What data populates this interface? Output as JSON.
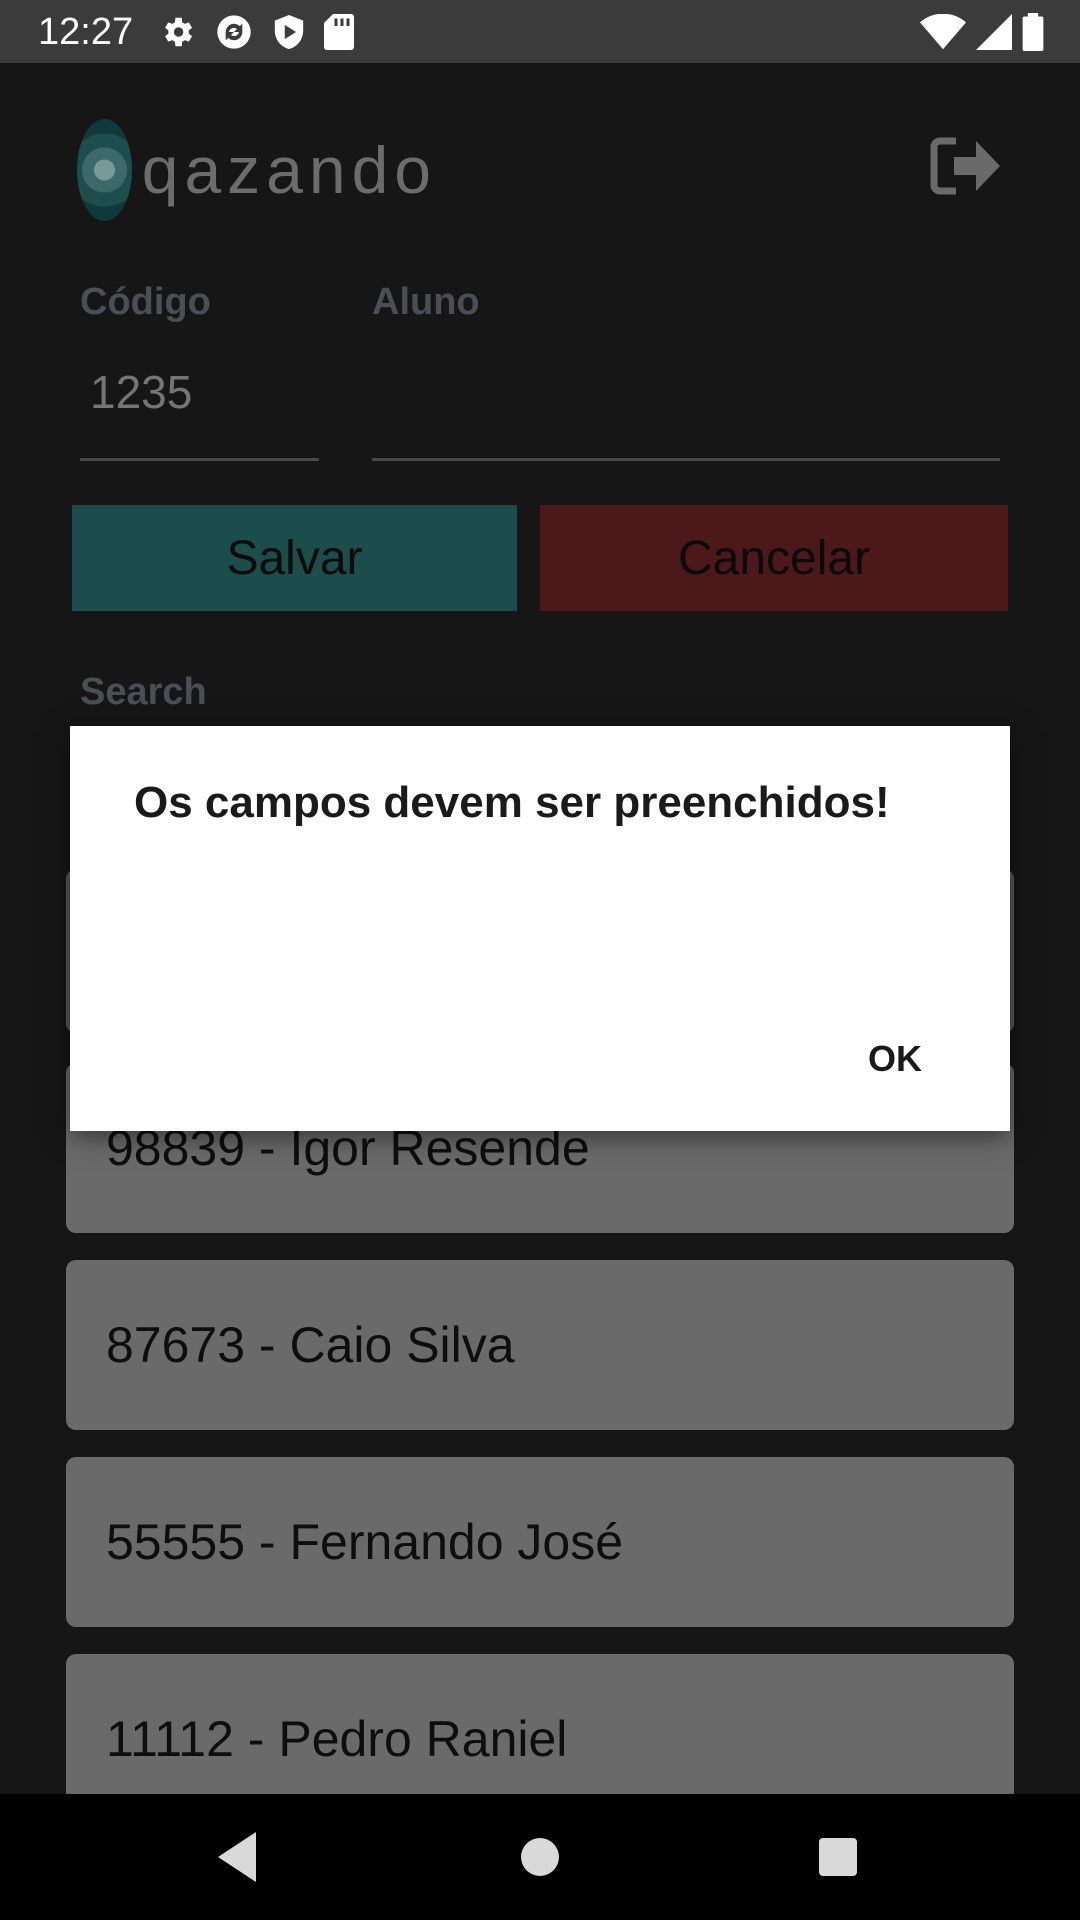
{
  "status_bar": {
    "time": "12:27",
    "left_icons": [
      "gear-icon",
      "sync-icon",
      "shield-icon",
      "sd-card-icon"
    ],
    "right_icons": [
      "wifi-icon",
      "signal-icon",
      "battery-icon"
    ]
  },
  "header": {
    "logo_text": "qazando",
    "logout_icon": "logout-icon"
  },
  "form": {
    "code_label": "Código",
    "code_value": "1235",
    "student_label": "Aluno",
    "student_value": ""
  },
  "buttons": {
    "save_label": "Salvar",
    "cancel_label": "Cancelar",
    "save_color": "#1d4c4c",
    "cancel_color": "#4c1819"
  },
  "search": {
    "label": "Search"
  },
  "students": [
    {
      "text": "98839 - Igor Resende"
    },
    {
      "text": "87673 - Caio Silva"
    },
    {
      "text": "55555 - Fernando José"
    },
    {
      "text": "11112 - Pedro Raniel"
    }
  ],
  "dialog": {
    "message": "Os campos devem ser preenchidos!",
    "ok_label": "OK"
  },
  "nav": {
    "back_icon": "back-icon",
    "home_icon": "home-icon",
    "recents_icon": "recents-icon"
  }
}
